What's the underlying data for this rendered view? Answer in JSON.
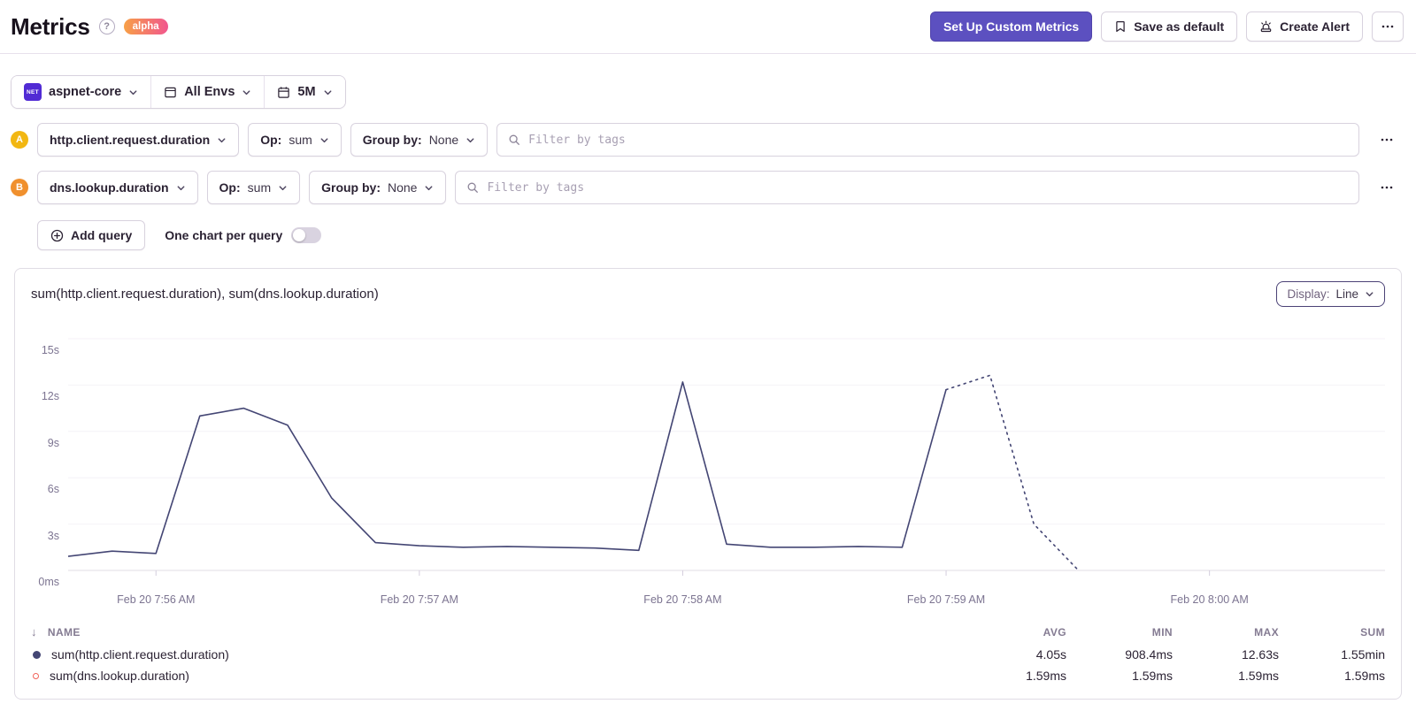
{
  "colors": {
    "accent": "#5c50c0",
    "series_a": "#444674",
    "series_b": "#f2635a",
    "badge_a": "#f2b712",
    "badge_b": "#f0902e",
    "alpha_badge_start": "#f7a046",
    "alpha_badge_end": "#f1568e"
  },
  "header": {
    "title": "Metrics",
    "help_icon": "?",
    "badge": "alpha",
    "actions": {
      "setup_custom_metrics": "Set Up Custom Metrics",
      "save_as_default": "Save as default",
      "create_alert": "Create Alert"
    }
  },
  "filters": {
    "project": {
      "platform": "NET",
      "name": "aspnet-core"
    },
    "environment": "All Envs",
    "date_range": "5M"
  },
  "queries": [
    {
      "id": "A",
      "badge_color": "#f2b712",
      "metric": "http.client.request.duration",
      "op_label": "Op:",
      "op": "sum",
      "group_by_label": "Group by:",
      "group_by": "None",
      "filter_placeholder": "Filter by tags"
    },
    {
      "id": "B",
      "badge_color": "#f0902e",
      "metric": "dns.lookup.duration",
      "op_label": "Op:",
      "op": "sum",
      "group_by_label": "Group by:",
      "group_by": "None",
      "filter_placeholder": "Filter by tags"
    }
  ],
  "query_toolbar": {
    "add_query": "Add query",
    "one_chart_per_query": "One chart per query",
    "toggle_on": false
  },
  "chart_panel": {
    "title": "sum(http.client.request.duration), sum(dns.lookup.duration)",
    "display_label": "Display:",
    "display_value": "Line"
  },
  "chart_data": {
    "type": "line",
    "title": "sum(http.client.request.duration), sum(dns.lookup.duration)",
    "y_axis": {
      "unit": "seconds",
      "max": 15,
      "ticks": [
        {
          "label": "0ms",
          "value": 0
        },
        {
          "label": "3s",
          "value": 3
        },
        {
          "label": "6s",
          "value": 6
        },
        {
          "label": "9s",
          "value": 9
        },
        {
          "label": "12s",
          "value": 12
        },
        {
          "label": "15s",
          "value": 15
        }
      ]
    },
    "x_axis": {
      "total_seconds": 300,
      "tick_labels": [
        "Feb 20 7:56 AM",
        "Feb 20 7:57 AM",
        "Feb 20 7:58 AM",
        "Feb 20 7:59 AM",
        "Feb 20 8:00 AM"
      ],
      "tick_fractions": [
        0.0667,
        0.2667,
        0.4667,
        0.6667,
        0.8667
      ]
    },
    "series": [
      {
        "name": "sum(http.client.request.duration)",
        "color": "#444674",
        "interval_seconds": 10,
        "solid_until_index": 20,
        "incomplete_tail_dotted": true,
        "values_seconds": [
          0.908,
          1.25,
          1.1,
          10.0,
          10.5,
          9.4,
          4.7,
          1.8,
          1.6,
          1.5,
          1.55,
          1.5,
          1.45,
          1.3,
          12.2,
          1.7,
          1.5,
          1.5,
          1.55,
          1.5,
          11.7,
          12.63,
          3.0,
          0.05
        ]
      },
      {
        "name": "sum(dns.lookup.duration)",
        "color": "#f2635a",
        "values_seconds": [
          0.00159
        ]
      }
    ]
  },
  "table": {
    "sort_icon": "↓",
    "headers": {
      "name": "NAME",
      "avg": "AVG",
      "min": "MIN",
      "max": "MAX",
      "sum": "SUM"
    },
    "rows": [
      {
        "marker": "filled",
        "marker_color": "#444674",
        "name": "sum(http.client.request.duration)",
        "avg": "4.05s",
        "min": "908.4ms",
        "max": "12.63s",
        "sum": "1.55min"
      },
      {
        "marker": "open",
        "marker_color": "#f2635a",
        "name": "sum(dns.lookup.duration)",
        "avg": "1.59ms",
        "min": "1.59ms",
        "max": "1.59ms",
        "sum": "1.59ms"
      }
    ]
  }
}
